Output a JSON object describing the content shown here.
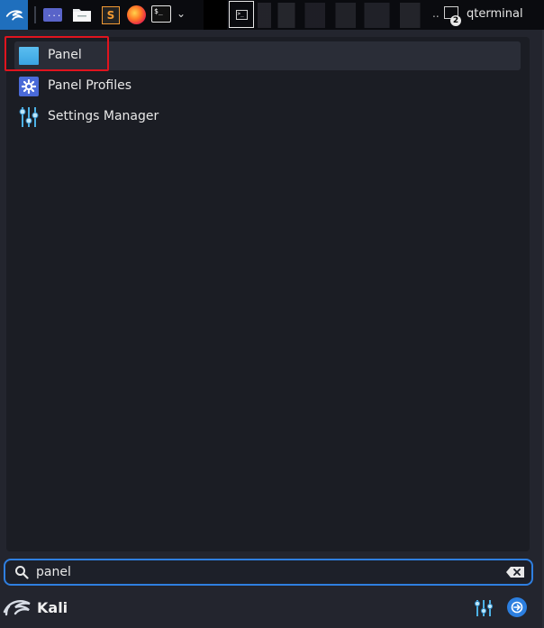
{
  "taskbar": {
    "apps": [
      {
        "name": "kali-menu-icon"
      },
      {
        "name": "workspace-icon"
      },
      {
        "name": "folder-icon"
      },
      {
        "name": "sublime-icon",
        "glyph": "S"
      },
      {
        "name": "firefox-icon"
      },
      {
        "name": "terminal-icon",
        "glyph": "$_"
      }
    ],
    "window_count_badge": "2",
    "window_title": "qterminal",
    "overflow": ".."
  },
  "results": [
    {
      "label": "Panel",
      "icon": "panel-icon",
      "active": true
    },
    {
      "label": "Panel Profiles",
      "icon": "gear-icon",
      "active": false
    },
    {
      "label": "Settings Manager",
      "icon": "settings-sliders-icon",
      "active": false
    }
  ],
  "search": {
    "value": "panel",
    "icon": "search-icon",
    "clear_icon": "backspace-clear-icon"
  },
  "footer": {
    "user": "Kali",
    "logo_icon": "kali-dragon-icon",
    "settings_icon": "settings-sliders-icon",
    "logout_icon": "logout-icon"
  },
  "colors": {
    "accent": "#2f7fe0",
    "highlight": "#e0141e",
    "panel_bg": "#1b1d24",
    "window_bg": "#23252e"
  }
}
